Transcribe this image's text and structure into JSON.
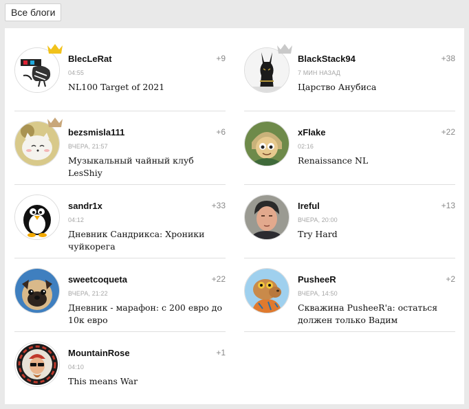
{
  "header": {
    "all_blogs_label": "Все блоги"
  },
  "blogs": [
    {
      "nick": "BlecLeRat",
      "score": "+9",
      "time": "04:55",
      "title": "NL100 Target of 2021",
      "crown": "gold",
      "avatar_icon": "rat-graffiti-avatar"
    },
    {
      "nick": "BlackStack94",
      "score": "+38",
      "time": "7 мин назад",
      "title": "Царство Анубиса",
      "crown": "silver",
      "avatar_icon": "anubis-avatar"
    },
    {
      "nick": "bezsmisla111",
      "score": "+6",
      "time": "вчера, 21:57",
      "title": "Музыкальный чайный клуб LesShiy",
      "crown": "bronze",
      "avatar_icon": "cat-avatar"
    },
    {
      "nick": "xFlake",
      "score": "+22",
      "time": "02:16",
      "title": "Renaissance NL",
      "crown": "",
      "avatar_icon": "cartoon-boy-avatar"
    },
    {
      "nick": "sandr1x",
      "score": "+33",
      "time": "04:12",
      "title": "Дневник Сандрикса: Хроники чуйкорега",
      "crown": "",
      "avatar_icon": "penguin-avatar"
    },
    {
      "nick": "Ireful",
      "score": "+13",
      "time": "вчера, 20:00",
      "title": "Try Hard",
      "crown": "",
      "avatar_icon": "man-photo-avatar"
    },
    {
      "nick": "sweetcoqueta",
      "score": "+22",
      "time": "вчера, 21:22",
      "title": "Дневник - марафон: с 200 евро до 10к евро",
      "crown": "",
      "avatar_icon": "pug-avatar"
    },
    {
      "nick": "PusheeR",
      "score": "+2",
      "time": "вчера, 14:50",
      "title": "Скважина PusheeR'a: остаться должен только Вадим",
      "crown": "",
      "avatar_icon": "capybara-avatar"
    },
    {
      "nick": "MountainRose",
      "score": "+1",
      "time": "04:10",
      "title": "This means War",
      "crown": "",
      "avatar_icon": "pro-badge-avatar"
    }
  ],
  "colors": {
    "crown_gold": "#f1c21b",
    "crown_silver": "#c9c9c9",
    "crown_bronze": "#c8a77a",
    "divider": "#dedede"
  }
}
